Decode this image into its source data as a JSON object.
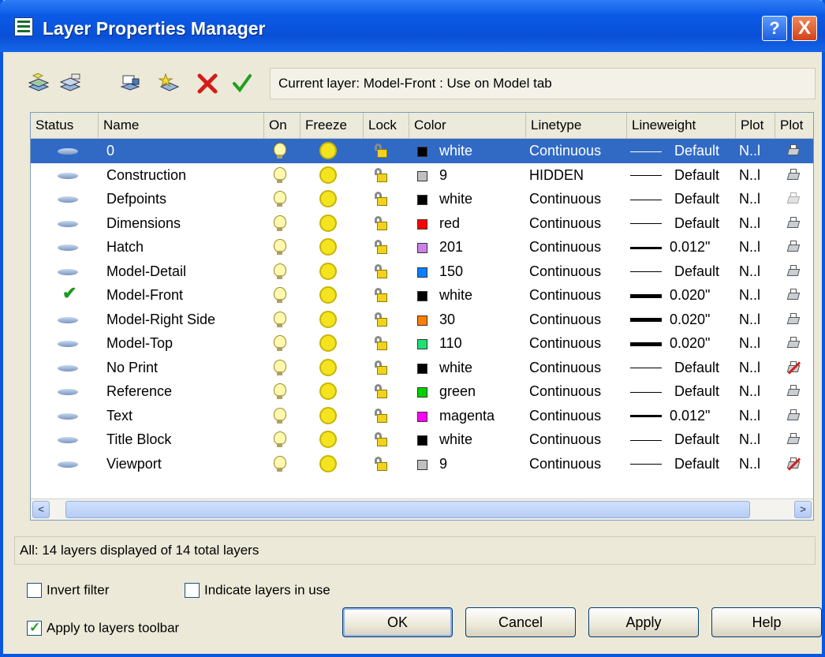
{
  "window": {
    "title": "Layer Properties Manager",
    "help_button": "?",
    "close_button": "X"
  },
  "toolbar": {
    "icons": [
      "new-property-filter-icon",
      "new-group-filter-icon",
      "layer-states-manager-icon",
      "new-layer-icon",
      "delete-layer-icon",
      "set-current-icon"
    ],
    "current_layer": "Current layer: Model-Front : Use on Model tab"
  },
  "table": {
    "headers": {
      "status": "Status",
      "name": "Name",
      "on": "On",
      "freeze": "Freeze",
      "lock": "Lock",
      "color": "Color",
      "linetype": "Linetype",
      "lineweight": "Lineweight",
      "plot_style": "Plot",
      "plot": "Plot"
    },
    "rows": [
      {
        "status": "layer",
        "name": "0",
        "color_name": "white",
        "color_hex": "#000000",
        "linetype": "Continuous",
        "lineweight": "Default",
        "lw_thickness": 1,
        "plot_style": "N..l",
        "plot": "on",
        "selected": true
      },
      {
        "status": "layer",
        "name": "Construction",
        "color_name": "9",
        "color_hex": "#c0c0c0",
        "linetype": "HIDDEN",
        "lineweight": "Default",
        "lw_thickness": 1,
        "plot_style": "N..l",
        "plot": "on",
        "selected": false
      },
      {
        "status": "layer",
        "name": "Defpoints",
        "color_name": "white",
        "color_hex": "#000000",
        "linetype": "Continuous",
        "lineweight": "Default",
        "lw_thickness": 1,
        "plot_style": "N..l",
        "plot": "off",
        "selected": false
      },
      {
        "status": "layer",
        "name": "Dimensions",
        "color_name": "red",
        "color_hex": "#ff0000",
        "linetype": "Continuous",
        "lineweight": "Default",
        "lw_thickness": 1,
        "plot_style": "N..l",
        "plot": "on",
        "selected": false
      },
      {
        "status": "layer",
        "name": "Hatch",
        "color_name": "201",
        "color_hex": "#cc80e6",
        "linetype": "Continuous",
        "lineweight": "0.012\"",
        "lw_thickness": 3,
        "plot_style": "N..l",
        "plot": "on",
        "selected": false
      },
      {
        "status": "layer",
        "name": "Model-Detail",
        "color_name": "150",
        "color_hex": "#0a7fff",
        "linetype": "Continuous",
        "lineweight": "Default",
        "lw_thickness": 1,
        "plot_style": "N..l",
        "plot": "on",
        "selected": false
      },
      {
        "status": "current",
        "name": "Model-Front",
        "color_name": "white",
        "color_hex": "#000000",
        "linetype": "Continuous",
        "lineweight": "0.020\"",
        "lw_thickness": 5,
        "plot_style": "N..l",
        "plot": "on",
        "selected": false
      },
      {
        "status": "layer",
        "name": "Model-Right Side",
        "color_name": "30",
        "color_hex": "#ff7f00",
        "linetype": "Continuous",
        "lineweight": "0.020\"",
        "lw_thickness": 5,
        "plot_style": "N..l",
        "plot": "on",
        "selected": false
      },
      {
        "status": "layer",
        "name": "Model-Top",
        "color_name": "110",
        "color_hex": "#20e070",
        "linetype": "Continuous",
        "lineweight": "0.020\"",
        "lw_thickness": 5,
        "plot_style": "N..l",
        "plot": "on",
        "selected": false
      },
      {
        "status": "layer",
        "name": "No Print",
        "color_name": "white",
        "color_hex": "#000000",
        "linetype": "Continuous",
        "lineweight": "Default",
        "lw_thickness": 1,
        "plot_style": "N..l",
        "plot": "noplot",
        "selected": false
      },
      {
        "status": "layer",
        "name": "Reference",
        "color_name": "green",
        "color_hex": "#00d000",
        "linetype": "Continuous",
        "lineweight": "Default",
        "lw_thickness": 1,
        "plot_style": "N..l",
        "plot": "on",
        "selected": false
      },
      {
        "status": "layer",
        "name": "Text",
        "color_name": "magenta",
        "color_hex": "#ff00ff",
        "linetype": "Continuous",
        "lineweight": "0.012\"",
        "lw_thickness": 3,
        "plot_style": "N..l",
        "plot": "on",
        "selected": false
      },
      {
        "status": "layer",
        "name": "Title Block",
        "color_name": "white",
        "color_hex": "#000000",
        "linetype": "Continuous",
        "lineweight": "Default",
        "lw_thickness": 1,
        "plot_style": "N..l",
        "plot": "on",
        "selected": false
      },
      {
        "status": "layer",
        "name": "Viewport",
        "color_name": "9",
        "color_hex": "#c0c0c0",
        "linetype": "Continuous",
        "lineweight": "Default",
        "lw_thickness": 1,
        "plot_style": "N..l",
        "plot": "noplot",
        "selected": false
      }
    ]
  },
  "scrollbar": {
    "left_arrow": "<",
    "right_arrow": ">"
  },
  "status_text": "All: 14 layers displayed of 14 total layers",
  "options": {
    "invert_filter": {
      "label": "Invert filter",
      "checked": false
    },
    "indicate_in_use": {
      "label": "Indicate layers in use",
      "checked": false
    },
    "apply_toolbar": {
      "label": "Apply to layers toolbar",
      "checked": true
    }
  },
  "buttons": {
    "ok": "OK",
    "cancel": "Cancel",
    "apply": "Apply",
    "help": "Help"
  },
  "colors": {
    "title_bar": "#0a5ae6",
    "selection": "#316ac5",
    "dialog": "#ece9d8"
  }
}
